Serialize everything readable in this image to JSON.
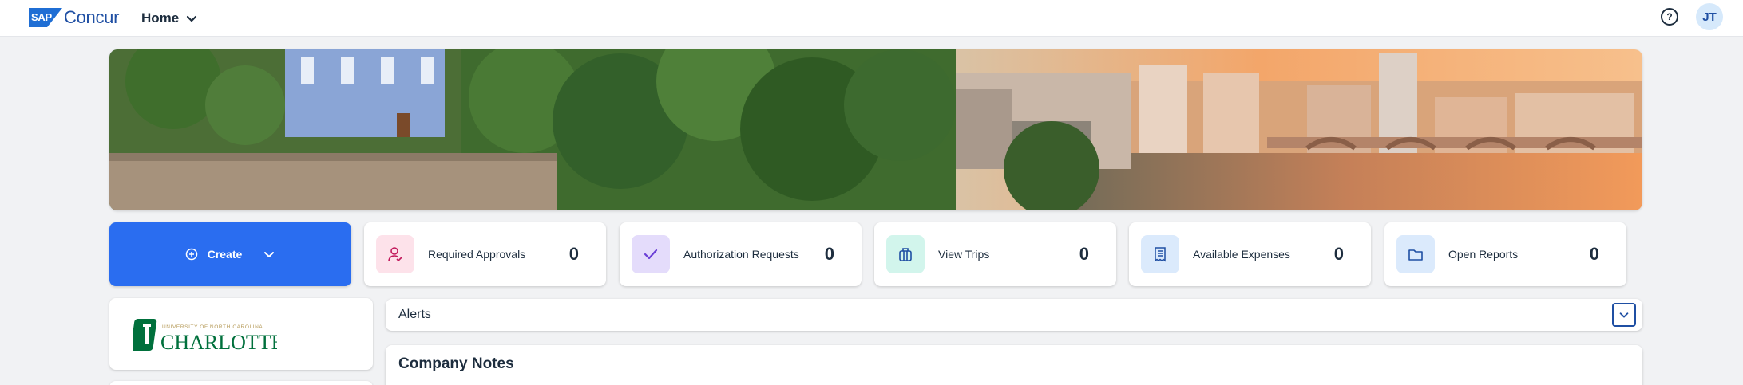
{
  "header": {
    "brand_mark": "SAP",
    "brand_name": "Concur",
    "nav_label": "Home",
    "user_initials": "JT"
  },
  "actions": {
    "create_label": "Create",
    "tiles": [
      {
        "label": "Required Approvals",
        "count": "0",
        "icon": "approval-person-icon",
        "color": "#fde2ea",
        "icon_color": "#c2185b"
      },
      {
        "label": "Authorization Requests",
        "count": "0",
        "icon": "checkmark-icon",
        "color": "#e4dcfb",
        "icon_color": "#6a3fd6"
      },
      {
        "label": "View Trips",
        "count": "0",
        "icon": "suitcase-icon",
        "color": "#d2f5ec",
        "icon_color": "#1f4fa3"
      },
      {
        "label": "Available Expenses",
        "count": "0",
        "icon": "receipt-icon",
        "color": "#dbeafc",
        "icon_color": "#1f4fa3"
      },
      {
        "label": "Open Reports",
        "count": "0",
        "icon": "folder-icon",
        "color": "#dbeafc",
        "icon_color": "#1f4fa3"
      }
    ]
  },
  "org": {
    "logo_small_text": "UNIVERSITY OF NORTH CAROLINA",
    "logo_main_text": "CHARLOTTE"
  },
  "alerts": {
    "title": "Alerts"
  },
  "company_notes": {
    "title": "Company Notes"
  },
  "colors": {
    "accent": "#2a6df0",
    "brand": "#1f4fa3",
    "uncc_green": "#00703c"
  }
}
